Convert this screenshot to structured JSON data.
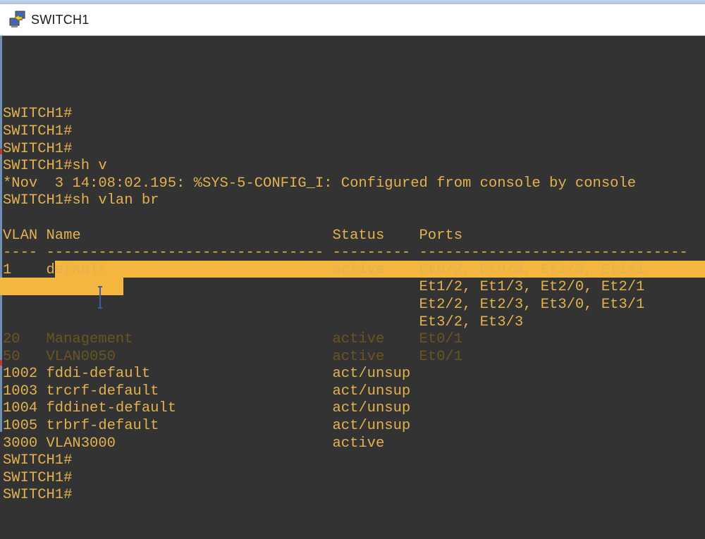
{
  "window": {
    "title": "SWITCH1",
    "icon": "network-terminal-icon"
  },
  "colors": {
    "terminal_bg": "#333333",
    "terminal_fg": "#e3b24f",
    "selection": "#f4b63f"
  },
  "terminal": {
    "lines": [
      "SWITCH1#",
      "SWITCH1#",
      "SWITCH1#",
      "SWITCH1#sh v",
      "*Nov  3 14:08:02.195: %SYS-5-CONFIG_I: Configured from console by console",
      "SWITCH1#sh vlan br",
      "",
      "VLAN Name                             Status    Ports",
      "---- -------------------------------- --------- -------------------------------",
      "1    default                          active    Et0/2, Et0/3, Et1/0, Et1/1",
      "                                                Et1/2, Et1/3, Et2/0, Et2/1",
      "                                                Et2/2, Et2/3, Et3/0, Et3/1",
      "                                                Et3/2, Et3/3",
      "20   Management                       active    Et0/1",
      "50   VLAN0050                         active    Et0/1",
      "1002 fddi-default                     act/unsup",
      "1003 trcrf-default                    act/unsup",
      "1004 fddinet-default                  act/unsup",
      "1005 trbrf-default                    act/unsup",
      "3000 VLAN3000                         active",
      "SWITCH1#",
      "SWITCH1#",
      "SWITCH1#"
    ],
    "vlan_table": {
      "headers": [
        "VLAN",
        "Name",
        "Status",
        "Ports"
      ],
      "rows": [
        {
          "vlan": "1",
          "name": "default",
          "status": "active",
          "ports": "Et0/2, Et0/3, Et1/0, Et1/1, Et1/2, Et1/3, Et2/0, Et2/1, Et2/2, Et2/3, Et3/0, Et3/1, Et3/2, Et3/3"
        },
        {
          "vlan": "20",
          "name": "Management",
          "status": "active",
          "ports": "Et0/1"
        },
        {
          "vlan": "50",
          "name": "VLAN0050",
          "status": "active",
          "ports": "Et0/1"
        },
        {
          "vlan": "1002",
          "name": "fddi-default",
          "status": "act/unsup",
          "ports": ""
        },
        {
          "vlan": "1003",
          "name": "trcrf-default",
          "status": "act/unsup",
          "ports": ""
        },
        {
          "vlan": "1004",
          "name": "fddinet-default",
          "status": "act/unsup",
          "ports": ""
        },
        {
          "vlan": "1005",
          "name": "trbrf-default",
          "status": "act/unsup",
          "ports": ""
        },
        {
          "vlan": "3000",
          "name": "VLAN3000",
          "status": "active",
          "ports": ""
        }
      ]
    },
    "selection": {
      "text": "anagement                       active    Et0/1\n50   VLAN0050"
    }
  }
}
